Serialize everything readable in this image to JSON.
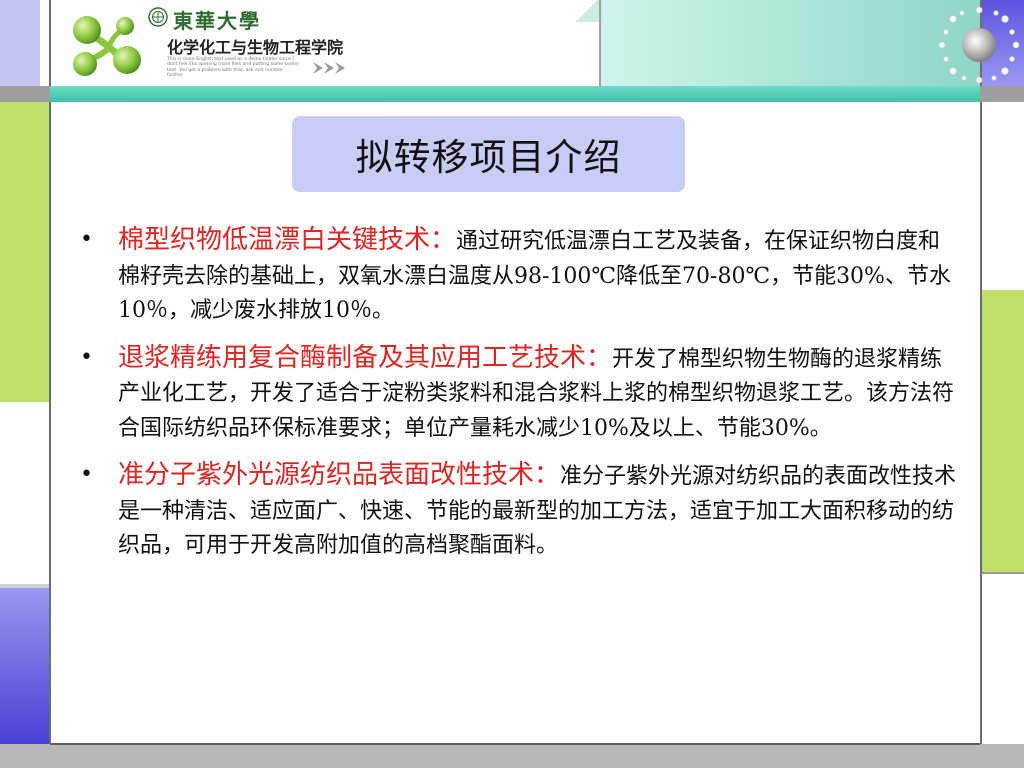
{
  "header": {
    "university": "東華大學",
    "school": "化学化工与生物工程学院",
    "tagline": "This is more English text used as a demo holder since I dont feel like opening more files and putting some Lorem text. You get a problem with that, ask and number further"
  },
  "slide": {
    "title": "拟转移项目介绍",
    "bullet_glyph": "•",
    "bullets": [
      {
        "heading": "棉型织物低温漂白关键技术：",
        "text": "通过研究低温漂白工艺及装备，在保证织物白度和棉籽壳去除的基础上，双氧水漂白温度从98-100℃降低至70-80℃，节能30%、节水10％，减少废水排放10％。"
      },
      {
        "heading": "退浆精练用复合酶制备及其应用工艺技术：",
        "text": "开发了棉型织物生物酶的退浆精练产业化工艺，开发了适合于淀粉类浆料和混合浆料上浆的棉型织物退浆工艺。该方法符合国际纺织品环保标准要求；单位产量耗水减少10%及以上、节能30%。"
      },
      {
        "heading": "准分子紫外光源纺织品表面改性技术：",
        "text": "准分子紫外光源对纺织品的表面改性技术是一种清洁、适应面广、快速、节能的最新型的加工方法，适宜于加工大面积移动的纺织品，可用于开发高附加值的高档聚酯面料。"
      }
    ]
  },
  "colors": {
    "heading_red": "#e32322",
    "title_box": "#c8ccf6",
    "teal_band": "#3fc0a6",
    "logo_green": "#7ac142"
  },
  "icons": [
    "school-logo-icon",
    "university-seal-icon",
    "double-arrow-icon",
    "sun-burst-icon"
  ]
}
